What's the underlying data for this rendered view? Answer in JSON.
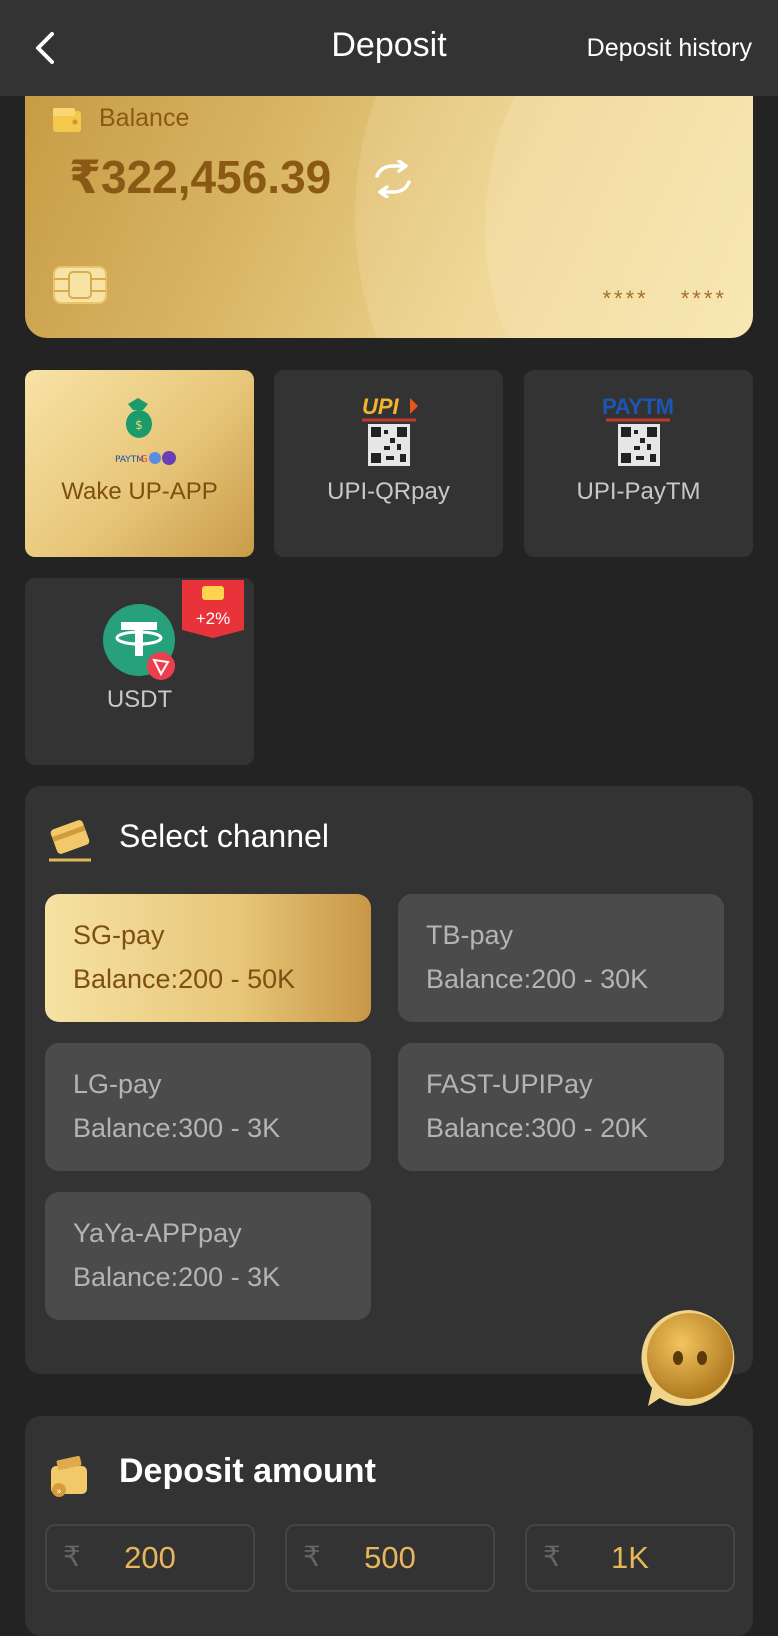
{
  "header": {
    "title": "Deposit",
    "history_link": "Deposit history",
    "back_icon": "chevron-left-icon"
  },
  "balance_card": {
    "label": "Balance",
    "amount": "₹322,456.39",
    "masked_1": "****",
    "masked_2": "****",
    "icons": [
      "wallet-icon",
      "refresh-icon",
      "chip-icon"
    ]
  },
  "payment_methods": [
    {
      "label": "Wake UP-APP",
      "icon": "money-bag-icon",
      "active": true
    },
    {
      "label": "UPI-QRpay",
      "icon": "upi-qr-icon",
      "logo_text": "UPI",
      "active": false
    },
    {
      "label": "UPI-PayTM",
      "icon": "paytm-qr-icon",
      "logo_text": "PAYTM",
      "active": false
    },
    {
      "label": "USDT",
      "icon": "tether-icon",
      "badge": "+2%",
      "active": false
    }
  ],
  "channel_section": {
    "title": "Select channel",
    "channels": [
      {
        "name": "SG-pay",
        "range": "Balance:200 - 50K",
        "active": true
      },
      {
        "name": "TB-pay",
        "range": "Balance:200 - 30K",
        "active": false
      },
      {
        "name": "LG-pay",
        "range": "Balance:300 - 3K",
        "active": false
      },
      {
        "name": "FAST-UPIPay",
        "range": "Balance:300 - 20K",
        "active": false
      },
      {
        "name": "YaYa-APPpay",
        "range": "Balance:200 - 3K",
        "active": false
      }
    ]
  },
  "amount_section": {
    "title": "Deposit amount",
    "currency_symbol": "₹",
    "options": [
      "200",
      "500",
      "1K"
    ]
  },
  "colors": {
    "accent_gold": "#e6b75a",
    "dark_brown": "#7e4f10",
    "panel_bg": "#333333",
    "page_bg": "#232323"
  }
}
